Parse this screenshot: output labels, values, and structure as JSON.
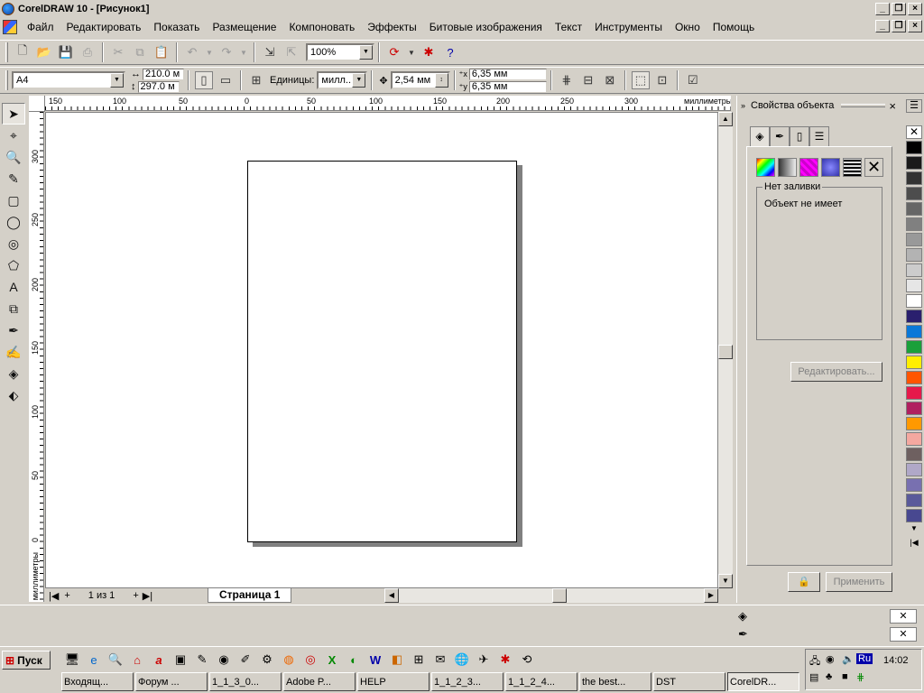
{
  "app": {
    "title": "CorelDRAW 10 - [Рисунок1]"
  },
  "menu": [
    "Файл",
    "Редактировать",
    "Показать",
    "Размещение",
    "Компоновать",
    "Эффекты",
    "Битовые изображения",
    "Текст",
    "Инструменты",
    "Окно",
    "Помощь"
  ],
  "toolbar1": {
    "zoom": "100%"
  },
  "toolbar2": {
    "page_size": "A4",
    "width": "210.0 м",
    "height": "297.0 м",
    "units_label": "Единицы:",
    "units_value": "милл...",
    "nudge": "2,54 мм",
    "dup_x": "6,35 мм",
    "dup_y": "6,35 мм"
  },
  "ruler": {
    "units": "миллиметры",
    "h_ticks": [
      "150",
      "100",
      "50",
      "0",
      "50",
      "100",
      "150",
      "200",
      "250",
      "300"
    ],
    "v_ticks": [
      "300",
      "250",
      "200",
      "150",
      "100",
      "50",
      "0"
    ]
  },
  "pagenav": {
    "counter": "1 из 1",
    "tab": "Страница 1"
  },
  "docker": {
    "title": "Свойства объекта",
    "group_caption": "Нет заливки",
    "group_text": "Объект не имеет",
    "edit_button": "Редактировать...",
    "apply_button": "Применить"
  },
  "palette": [
    "#000000",
    "#1a1a1a",
    "#333333",
    "#4d4d4d",
    "#666666",
    "#808080",
    "#999999",
    "#b3b3b3",
    "#cccccc",
    "#e6e6e6",
    "#ffffff",
    "#2a1f6e",
    "#0a78d8",
    "#1aa03a",
    "#ffee00",
    "#ff5500",
    "#e6194b",
    "#b02060",
    "#ff9900",
    "#f4a8a0",
    "#6e6060",
    "#b0a8c8",
    "#7870b0",
    "#5a5a9a",
    "#484890"
  ],
  "taskbar": {
    "start": "Пуск",
    "tasks": [
      "Входящ...",
      "Форум ...",
      "1_1_3_0...",
      "Adobe P...",
      "HELP",
      "1_1_2_3...",
      "1_1_2_4...",
      "the best...",
      "DST",
      "CorelDR..."
    ],
    "clock": "14:02",
    "lang": "Ru"
  }
}
